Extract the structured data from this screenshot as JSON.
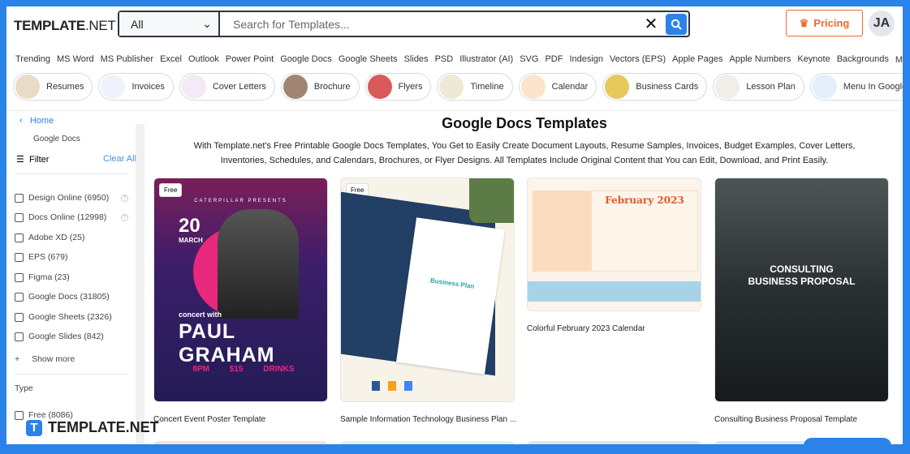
{
  "header": {
    "logo_bold": "TEMPLATE",
    "logo_rest": ".NET",
    "category": "All",
    "search_placeholder": "Search for Templates...",
    "pricing": "Pricing",
    "avatar": "JA"
  },
  "nav": [
    "Trending",
    "MS Word",
    "MS Publisher",
    "Excel",
    "Outlook",
    "Power Point",
    "Google Docs",
    "Google Sheets",
    "Slides",
    "PSD",
    "Illustrator (AI)",
    "SVG",
    "PDF",
    "Indesign",
    "Vectors (EPS)",
    "Apple Pages",
    "Apple Numbers",
    "Keynote",
    "Backgrounds",
    "More"
  ],
  "chips": [
    "Resumes",
    "Invoices",
    "Cover Letters",
    "Brochure",
    "Flyers",
    "Timeline",
    "Calendar",
    "Business Cards",
    "Lesson Plan",
    "Menu In Google Docs"
  ],
  "sidebar": {
    "home": "Home",
    "crumb": "Google Docs",
    "filter": "Filter",
    "clear": "Clear All",
    "options": [
      "Design Online (6950)",
      "Docs Online (12998)",
      "Adobe XD (25)",
      "EPS (679)",
      "Figma (23)",
      "Google Docs (31805)",
      "Google Sheets (2326)",
      "Google Slides (842)"
    ],
    "show_more": "Show more",
    "type_heading": "Type",
    "type_options": [
      "Free (8086)"
    ]
  },
  "main": {
    "title": "Google Docs Templates",
    "description": "With Template.net's Free Printable Google Docs Templates, You Get to Easily Create Document Layouts, Resume Samples, Invoices, Budget Examples, Cover Letters, Inventories, Schedules, and Calendars, Brochures, or Flyer Designs. All Templates Include Original Content that You can Edit, Download, and Print Easily.",
    "badge": "Free",
    "cards": [
      {
        "title": "Concert Event Poster Template",
        "poster": {
          "presents": "CATERPILLAR PRESENTS",
          "day": "20",
          "month": "MARCH",
          "concert": "concert with",
          "name": "PAUL GRAHAM",
          "cols": [
            "8PM",
            "$15",
            "DRINKS"
          ]
        }
      },
      {
        "title": "Sample Information Technology Business Plan ...",
        "doc": "Business Plan"
      },
      {
        "title": "Colorful February 2023 Calendar",
        "month": "February 2023"
      },
      {
        "title": "Consulting Business Proposal Template",
        "heading1": "CONSULTING",
        "heading2": "BUSINESS PROPOSAL"
      }
    ]
  },
  "footer_logo": "TEMPLATE.NET",
  "colors": {
    "brand": "#2b82e8",
    "pricing": "#f26a2b"
  }
}
